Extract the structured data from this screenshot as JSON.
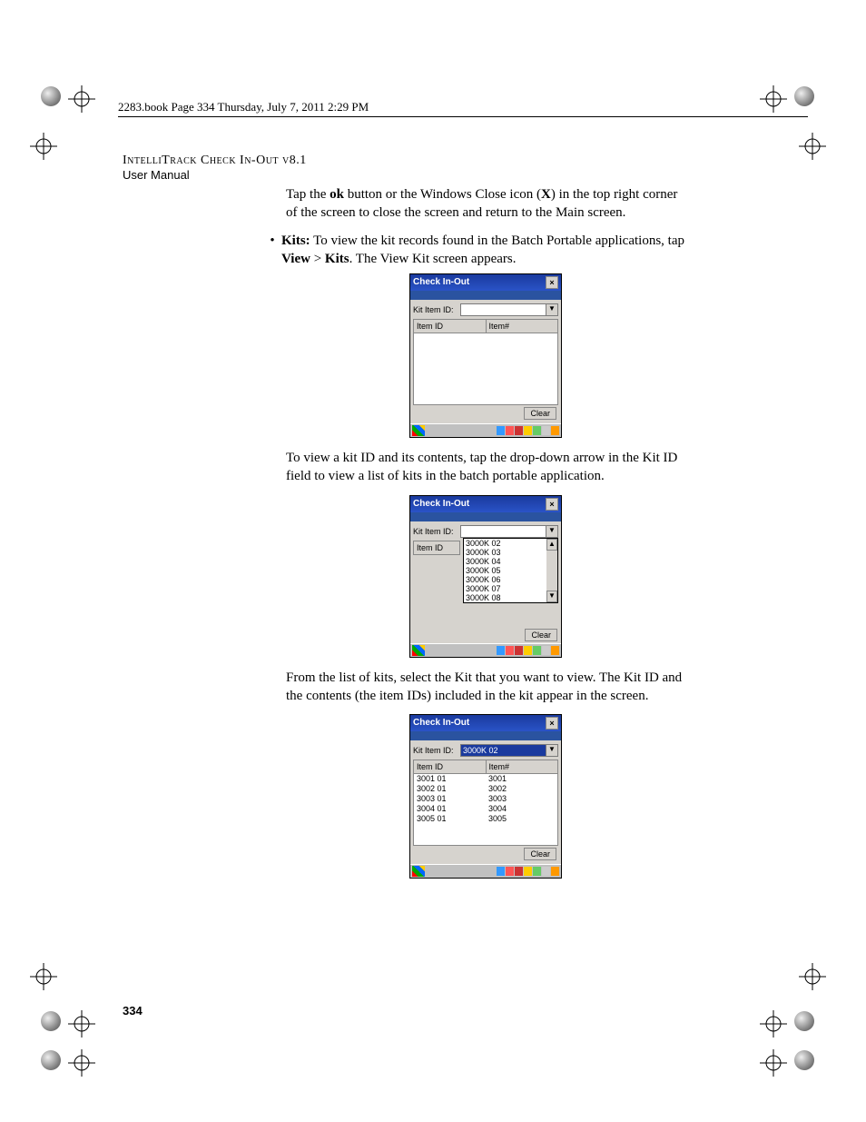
{
  "crop_header": "2283.book  Page 334  Thursday, July 7, 2011  2:29 PM",
  "doc_title": "IntelliTrack Check In-Out v8.1",
  "doc_subtitle": "User Manual",
  "p1_a": "Tap the ",
  "p1_b": "ok",
  "p1_c": " button or the Windows Close icon (",
  "p1_d": "X",
  "p1_e": ")  in the top right corner of the screen to close the screen and return to the Main screen.",
  "bullet_label": "Kits:",
  "bullet_text": " To view the kit records found in the Batch Portable applications, tap ",
  "bullet_view": "View",
  "bullet_gt": " > ",
  "bullet_kits": "Kits",
  "bullet_tail": ". The View Kit screen appears.",
  "p2": "To view a kit ID and its contents, tap the drop-down arrow in the Kit ID field to view a list of kits in the batch portable application.",
  "p3": "From the list of kits, select the Kit that you want to view. The Kit ID and the contents (the item IDs) included in the kit appear in the screen.",
  "page_num": "334",
  "mini": {
    "title": "Check In-Out",
    "close": "×",
    "kit_label": "Kit Item ID:",
    "col_itemid": "Item ID",
    "col_itemno": "Item#",
    "clear": "Clear",
    "dd_arrow": "▼",
    "up_arrow": "▲",
    "list": [
      "3000K 02",
      "3000K 03",
      "3000K 04",
      "3000K 05",
      "3000K 06",
      "3000K 07",
      "3000K 08"
    ],
    "selected": "3000K 02",
    "rows_id": [
      "3001 01",
      "3002 01",
      "3003 01",
      "3004 01",
      "3005 01"
    ],
    "rows_no": [
      "3001",
      "3002",
      "3003",
      "3004",
      "3005"
    ]
  }
}
